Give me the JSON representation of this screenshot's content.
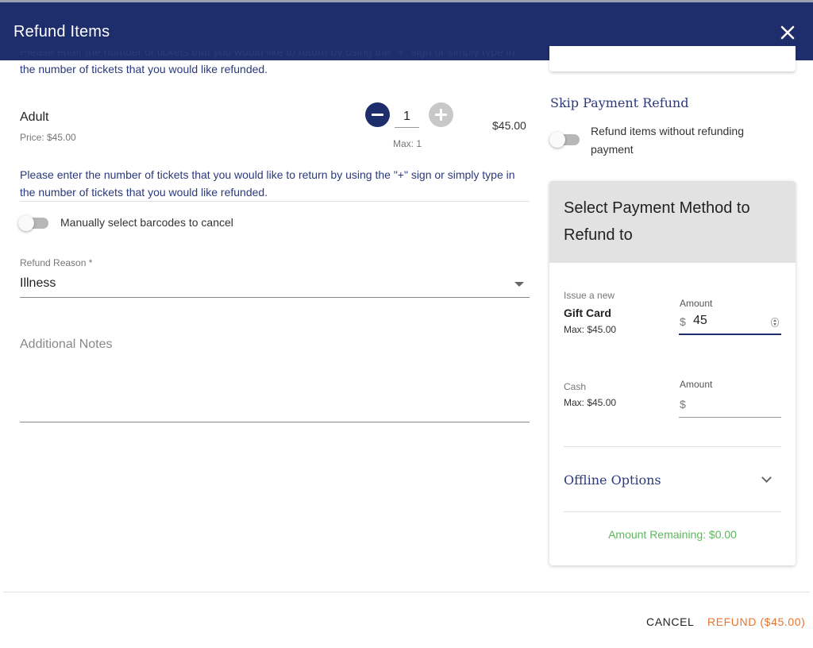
{
  "header": {
    "title": "Refund Items",
    "close_icon": "close-icon"
  },
  "instructions": {
    "text": "Please enter the number of tickets that you would like to return by using the \"+\" sign or simply type in the number of tickets that you would like refunded."
  },
  "ticket": {
    "name": "Adult",
    "price": "Price: $45.00",
    "quantity": "1",
    "max": "Max: 1",
    "total": "$45.00"
  },
  "barcodes": {
    "toggle_label": "Manually select barcodes to cancel",
    "enabled": false
  },
  "refund_reason": {
    "label": "Refund Reason *",
    "value": "Illness"
  },
  "notes": {
    "placeholder": "Additional Notes"
  },
  "skip_payment": {
    "title": "Skip Payment Refund",
    "toggle_label": "Refund items without refunding payment",
    "enabled": false
  },
  "payment_method": {
    "title": "Select Payment Method to Refund to",
    "gift_card": {
      "label_small": "Issue a new",
      "label": "Gift Card",
      "max": "Max: $45.00",
      "amount_label": "Amount",
      "currency": "$",
      "amount": "45"
    },
    "cash": {
      "label_small": "Cash",
      "max": "Max: $45.00",
      "amount_label": "Amount",
      "currency": "$",
      "amount": ""
    },
    "offline_options": "Offline Options",
    "remaining": "Amount Remaining: $0.00"
  },
  "footer": {
    "cancel": "CANCEL",
    "refund": "REFUND ($45.00)"
  },
  "colors": {
    "primary": "#1e2d6b",
    "accent": "#e8732e",
    "success": "#5cb85c"
  }
}
